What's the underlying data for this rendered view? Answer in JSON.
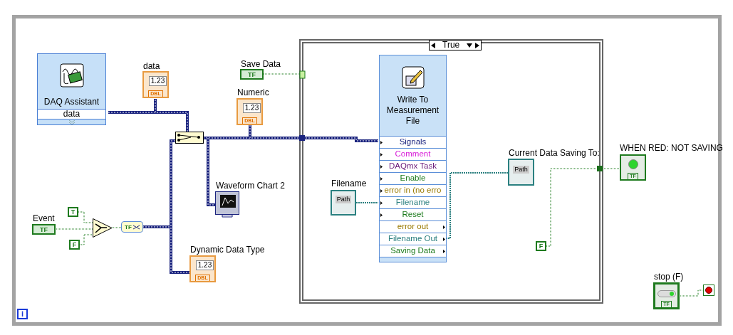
{
  "case_selector": {
    "value": "True"
  },
  "daq_assistant": {
    "title": "DAQ Assistant",
    "output": "data"
  },
  "indicators": [
    {
      "label": "data",
      "display": "1.23",
      "type": "DBL"
    },
    {
      "label": "Numeric",
      "display": "1.23",
      "type": "DBL"
    },
    {
      "label": "Dynamic Data Type",
      "display": "1.23",
      "type": "DBL"
    }
  ],
  "boolean_controls": [
    {
      "label": "Save Data",
      "glyph": "TF"
    },
    {
      "label": "Event",
      "glyph": "TF"
    }
  ],
  "constants": [
    {
      "text": "T"
    },
    {
      "text": "F"
    },
    {
      "text": "F"
    }
  ],
  "conversion": {
    "text": "TF"
  },
  "waveform_chart": {
    "label": "Waveform Chart 2"
  },
  "write_file": {
    "title": "Write To Measurement File",
    "terminals": [
      {
        "name": "Signals",
        "color": "#1a237e",
        "kind": "input"
      },
      {
        "name": "Comment",
        "color": "#d81bd8",
        "kind": "input"
      },
      {
        "name": "DAQmx Task",
        "color": "#6a1b7a",
        "kind": "input"
      },
      {
        "name": "Enable",
        "color": "#1b7a1b",
        "kind": "input"
      },
      {
        "name": "error in (no erro",
        "color": "#9a7a00",
        "kind": "input"
      },
      {
        "name": "Filename",
        "color": "#2a7f7f",
        "kind": "input"
      },
      {
        "name": "Reset",
        "color": "#1b7a1b",
        "kind": "input"
      },
      {
        "name": "error out",
        "color": "#9a7a00",
        "kind": "output"
      },
      {
        "name": "Filename Out",
        "color": "#2a7f7f",
        "kind": "output"
      },
      {
        "name": "Saving Data",
        "color": "#1b7a1b",
        "kind": "output"
      }
    ]
  },
  "path_control": {
    "label": "Filename",
    "text": "Path"
  },
  "path_indicator": {
    "label": "Current Data Saving To:",
    "text": "Path"
  },
  "led": {
    "label": "WHEN RED: NOT SAVING",
    "on": true,
    "glyph": "TF"
  },
  "stop": {
    "label": "stop (F)",
    "glyph": "TF"
  },
  "iteration": {
    "text": "i"
  }
}
